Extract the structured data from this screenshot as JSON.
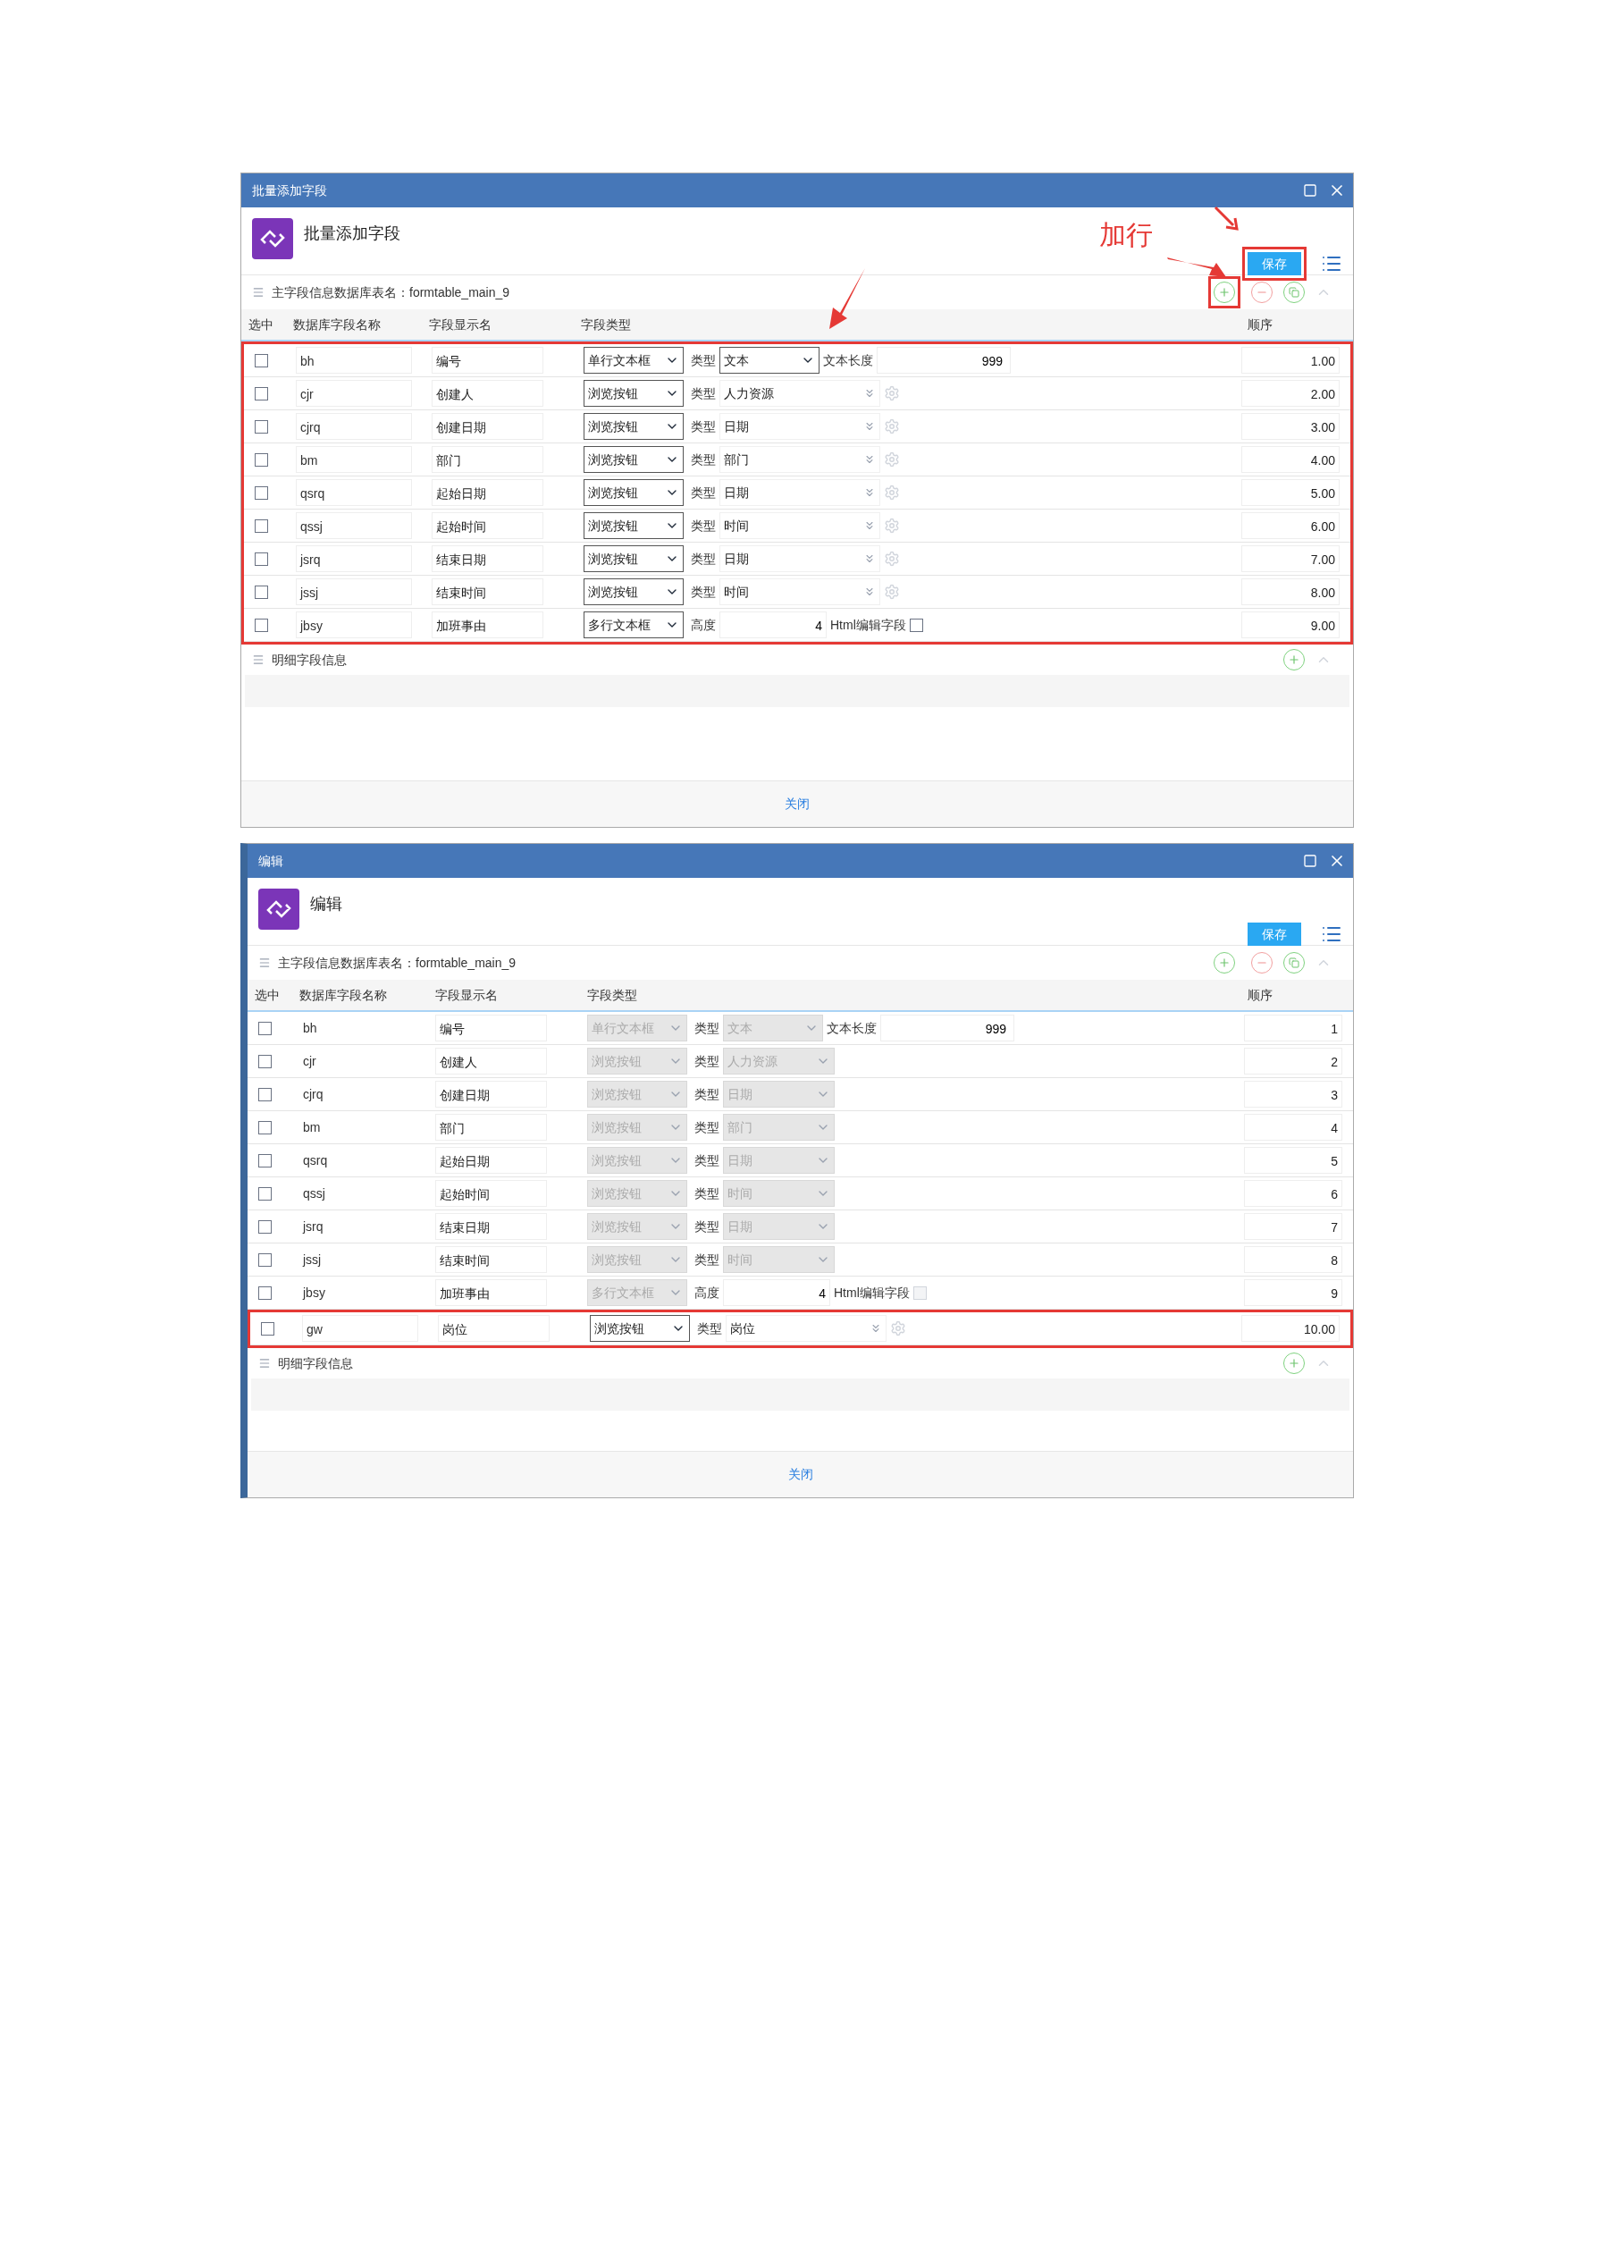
{
  "dialogs": [
    {
      "window": {
        "title": "批量添加字段"
      },
      "header": {
        "title": "批量添加字段"
      },
      "save_button": {
        "label": "保存",
        "highlighted": true
      },
      "annotation": {
        "text": "加行"
      },
      "main_section": {
        "title": "主字段信息数据库表名：formtable_main_9",
        "add_highlighted": true
      },
      "columns": [
        "选中",
        "数据库字段名称",
        "字段显示名",
        "字段类型",
        "顺序"
      ],
      "rows": [
        {
          "kind": "text",
          "checked": false,
          "disabled": false,
          "highlighted": true,
          "name": "bh",
          "label": "编号",
          "field_type": "单行文本框",
          "type_label": "类型",
          "type_value": "文本",
          "extra_label": "文本长度",
          "extra_value": "999",
          "order": "1.00"
        },
        {
          "kind": "browse",
          "checked": false,
          "disabled": false,
          "highlighted": true,
          "name": "cjr",
          "label": "创建人",
          "field_type": "浏览按钮",
          "type_label": "类型",
          "type_value": "人力资源",
          "order": "2.00"
        },
        {
          "kind": "browse",
          "checked": false,
          "disabled": false,
          "highlighted": true,
          "name": "cjrq",
          "label": "创建日期",
          "field_type": "浏览按钮",
          "type_label": "类型",
          "type_value": "日期",
          "order": "3.00"
        },
        {
          "kind": "browse",
          "checked": false,
          "disabled": false,
          "highlighted": true,
          "name": "bm",
          "label": "部门",
          "field_type": "浏览按钮",
          "type_label": "类型",
          "type_value": "部门",
          "order": "4.00"
        },
        {
          "kind": "browse",
          "checked": false,
          "disabled": false,
          "highlighted": true,
          "name": "qsrq",
          "label": "起始日期",
          "field_type": "浏览按钮",
          "type_label": "类型",
          "type_value": "日期",
          "order": "5.00"
        },
        {
          "kind": "browse",
          "checked": false,
          "disabled": false,
          "highlighted": true,
          "name": "qssj",
          "label": "起始时间",
          "field_type": "浏览按钮",
          "type_label": "类型",
          "type_value": "时间",
          "order": "6.00"
        },
        {
          "kind": "browse",
          "checked": false,
          "disabled": false,
          "highlighted": true,
          "name": "jsrq",
          "label": "结束日期",
          "field_type": "浏览按钮",
          "type_label": "类型",
          "type_value": "日期",
          "order": "7.00"
        },
        {
          "kind": "browse",
          "checked": false,
          "disabled": false,
          "highlighted": true,
          "name": "jssj",
          "label": "结束时间",
          "field_type": "浏览按钮",
          "type_label": "类型",
          "type_value": "时间",
          "order": "8.00"
        },
        {
          "kind": "textarea",
          "checked": false,
          "disabled": false,
          "highlighted": true,
          "name": "jbsy",
          "label": "加班事由",
          "field_type": "多行文本框",
          "type_label": "高度",
          "extra_value": "4",
          "html_label": "Html编辑字段",
          "html_checked": false,
          "order": "9.00"
        }
      ],
      "detail_section": {
        "title": "明细字段信息"
      },
      "close_button": "关闭"
    },
    {
      "window": {
        "title": "编辑"
      },
      "header": {
        "title": "编辑"
      },
      "save_button": {
        "label": "保存",
        "highlighted": false
      },
      "main_section": {
        "title": "主字段信息数据库表名：formtable_main_9",
        "add_highlighted": false
      },
      "columns": [
        "选中",
        "数据库字段名称",
        "字段显示名",
        "字段类型",
        "顺序"
      ],
      "rows": [
        {
          "kind": "text",
          "checked": false,
          "disabled": true,
          "highlighted": false,
          "name": "bh",
          "label": "编号",
          "field_type": "单行文本框",
          "type_label": "类型",
          "type_value": "文本",
          "extra_label": "文本长度",
          "extra_value": "999",
          "order": "1"
        },
        {
          "kind": "browse",
          "checked": false,
          "disabled": true,
          "highlighted": false,
          "name": "cjr",
          "label": "创建人",
          "field_type": "浏览按钮",
          "type_label": "类型",
          "type_value": "人力资源",
          "order": "2"
        },
        {
          "kind": "browse",
          "checked": false,
          "disabled": true,
          "highlighted": false,
          "name": "cjrq",
          "label": "创建日期",
          "field_type": "浏览按钮",
          "type_label": "类型",
          "type_value": "日期",
          "order": "3"
        },
        {
          "kind": "browse",
          "checked": false,
          "disabled": true,
          "highlighted": false,
          "name": "bm",
          "label": "部门",
          "field_type": "浏览按钮",
          "type_label": "类型",
          "type_value": "部门",
          "order": "4"
        },
        {
          "kind": "browse",
          "checked": false,
          "disabled": true,
          "highlighted": false,
          "name": "qsrq",
          "label": "起始日期",
          "field_type": "浏览按钮",
          "type_label": "类型",
          "type_value": "日期",
          "order": "5"
        },
        {
          "kind": "browse",
          "checked": false,
          "disabled": true,
          "highlighted": false,
          "name": "qssj",
          "label": "起始时间",
          "field_type": "浏览按钮",
          "type_label": "类型",
          "type_value": "时间",
          "order": "6"
        },
        {
          "kind": "browse",
          "checked": false,
          "disabled": true,
          "highlighted": false,
          "name": "jsrq",
          "label": "结束日期",
          "field_type": "浏览按钮",
          "type_label": "类型",
          "type_value": "日期",
          "order": "7"
        },
        {
          "kind": "browse",
          "checked": false,
          "disabled": true,
          "highlighted": false,
          "name": "jssj",
          "label": "结束时间",
          "field_type": "浏览按钮",
          "type_label": "类型",
          "type_value": "时间",
          "order": "8"
        },
        {
          "kind": "textarea",
          "checked": false,
          "disabled": true,
          "highlighted": false,
          "name": "jbsy",
          "label": "加班事由",
          "field_type": "多行文本框",
          "type_label": "高度",
          "extra_value": "4",
          "html_label": "Html编辑字段",
          "html_checked": false,
          "order": "9"
        },
        {
          "kind": "browse",
          "checked": false,
          "disabled": false,
          "highlighted": true,
          "name": "gw",
          "label": "岗位",
          "field_type": "浏览按钮",
          "type_label": "类型",
          "type_value": "岗位",
          "order": "10.00"
        }
      ],
      "detail_section": {
        "title": "明细字段信息"
      },
      "close_button": "关闭"
    }
  ]
}
